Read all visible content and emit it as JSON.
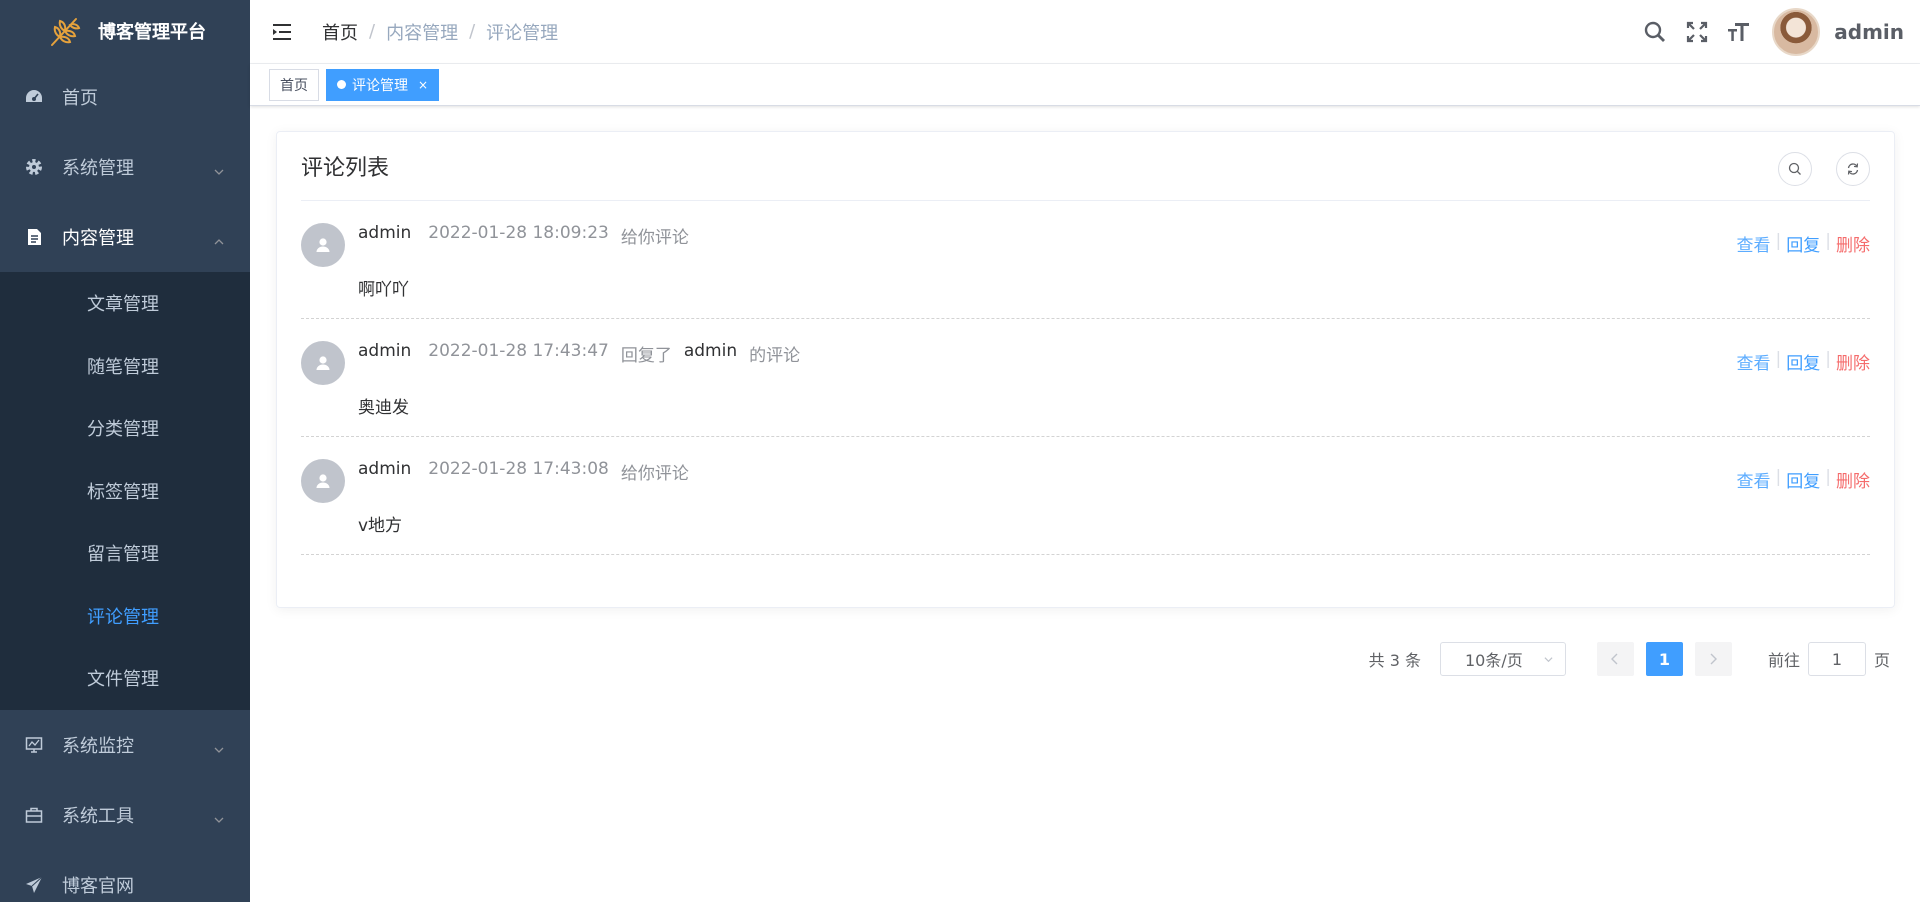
{
  "app": {
    "title": "博客管理平台",
    "logo_icon": "wheat-icon"
  },
  "sidebar": {
    "items": [
      {
        "label": "首页",
        "icon": "dashboard-icon"
      },
      {
        "label": "系统管理",
        "icon": "gear-icon"
      },
      {
        "label": "内容管理",
        "icon": "document-icon"
      },
      {
        "label": "系统监控",
        "icon": "monitor-icon"
      },
      {
        "label": "系统工具",
        "icon": "toolbox-icon"
      },
      {
        "label": "博客官网",
        "icon": "paper-plane-icon"
      }
    ],
    "content_submenu": [
      "文章管理",
      "随笔管理",
      "分类管理",
      "标签管理",
      "留言管理",
      "评论管理",
      "文件管理"
    ],
    "active_item": "评论管理"
  },
  "header": {
    "breadcrumb": [
      "首页",
      "内容管理",
      "评论管理"
    ],
    "separator": "/",
    "user": "admin"
  },
  "tags": [
    {
      "label": "首页"
    },
    {
      "label": "评论管理",
      "close": "×"
    }
  ],
  "card": {
    "title": "评论列表"
  },
  "comments": [
    {
      "user": "admin",
      "time": "2022-01-28 18:09:23",
      "action": "给你评论",
      "target": "",
      "suffix": "",
      "content": "啊吖吖"
    },
    {
      "user": "admin",
      "time": "2022-01-28 17:43:47",
      "action": "回复了",
      "target": "admin",
      "suffix": "的评论",
      "content": "奥迪发"
    },
    {
      "user": "admin",
      "time": "2022-01-28 17:43:08",
      "action": "给你评论",
      "target": "",
      "suffix": "",
      "content": "v地方"
    }
  ],
  "actions": {
    "view": "查看",
    "reply": "回复",
    "delete": "删除",
    "sep": "|"
  },
  "pagination": {
    "total": "共 3 条",
    "page_size": "10条/页",
    "current": "1",
    "goto_prefix": "前往",
    "goto_value": "1",
    "goto_suffix": "页"
  },
  "colors": {
    "sidebar_bg": "#304156",
    "submenu_bg": "#1f2d3d",
    "accent": "#409eff",
    "danger": "#f56c6c"
  }
}
